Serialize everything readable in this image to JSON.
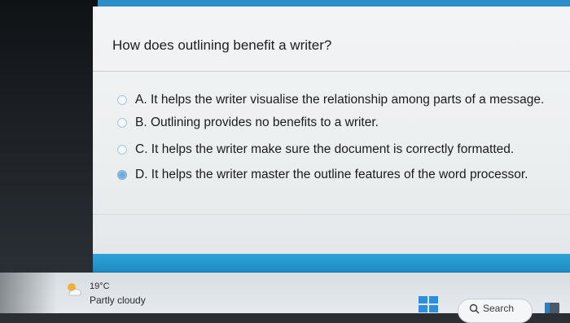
{
  "quiz": {
    "question": "How does outlining benefit a writer?",
    "options": [
      {
        "label": "A. It helps the writer visualise the relationship among parts of a message.",
        "selected": false
      },
      {
        "label": "B. Outlining provides no benefits to a writer.",
        "selected": false
      },
      {
        "label": "C. It helps the writer make sure the document is correctly formatted.",
        "selected": false
      },
      {
        "label": "D. It helps the writer master the outline features of the word processor.",
        "selected": true
      }
    ]
  },
  "taskbar": {
    "weather": {
      "temperature": "19°C",
      "condition": "Partly cloudy",
      "icon": "partly-cloudy-icon"
    },
    "start_icon": "windows-logo-icon",
    "search": {
      "label": "Search",
      "icon": "search-icon"
    },
    "pinned_app_icon": "app-icon"
  },
  "colors": {
    "accent_blue": "#1e8cc4",
    "selected_radio": "#5fa3d6",
    "page_background": "#eceff0"
  }
}
